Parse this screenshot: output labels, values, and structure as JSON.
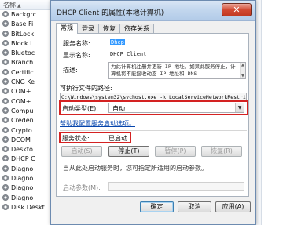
{
  "services_list": {
    "header": "名称",
    "items": [
      "Backgrc",
      "Base Fi",
      "BitLock",
      "Block L",
      "Bluetoc",
      "Branch",
      "Certific",
      "CNG Ke",
      "COM+",
      "COM+",
      "Compu",
      "Creden",
      "Crypto",
      "DCOM",
      "Deskto",
      "DHCP C",
      "Diagno",
      "Diagno",
      "Diagno",
      "Diagno",
      "Disk Deskt"
    ]
  },
  "dialog": {
    "title": "DHCP Client 的属性(本地计算机)",
    "close_glyph": "✕",
    "tabs": [
      "常规",
      "登录",
      "恢复",
      "依存关系"
    ],
    "fields": {
      "service_name_label": "服务名称:",
      "service_name_value": "Dhcp",
      "display_name_label": "显示名称:",
      "display_name_value": "DHCP Client",
      "description_label": "描述:",
      "description_value": "为此计算机注册并更新 IP 地址。如果此服务停止，计算机将不能接收动态 IP 地址和 DNS",
      "path_label": "可执行文件的路径:",
      "path_value": "C:\\Windows\\system32\\svchost.exe -k LocalServiceNetworkRestri",
      "startup_type_label": "启动类型(E):",
      "startup_type_value": "自动",
      "help_link": "帮助我配置服务启动选项。",
      "status_label": "服务状态:",
      "status_value": "已启动",
      "hint": "当从此处启动服务时，您可指定所适用的启动参数。",
      "params_label": "启动参数(M):"
    },
    "service_buttons": {
      "start": "启动(S)",
      "stop": "停止(T)",
      "pause": "暂停(P)",
      "resume": "恢复(R)"
    },
    "footer_buttons": {
      "ok": "确定",
      "cancel": "取消",
      "apply": "应用(A)"
    }
  },
  "colors": {
    "highlight_box": "#d42222",
    "selection": "#3399ff",
    "link": "#0645ad"
  }
}
